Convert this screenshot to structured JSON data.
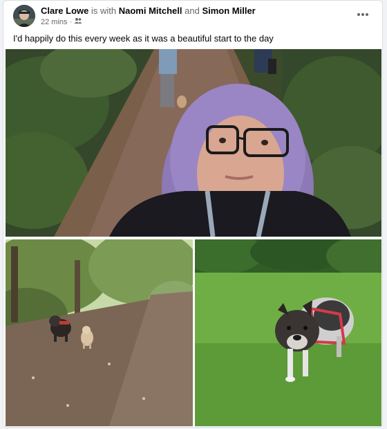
{
  "post": {
    "author": "Clare Lowe",
    "with_word": "is with",
    "tagged": [
      "Naomi Mitchell",
      "Simon Miller"
    ],
    "and_word": "and",
    "time": "22 mins",
    "separator": "·",
    "audience_icon": "friends-icon",
    "caption": "I'd happily do this every week as it was a beautiful start to the day",
    "more_icon": "more-options-icon"
  },
  "photos": [
    {
      "subject": "selfie-on-woodland-path"
    },
    {
      "subject": "dogs-on-path"
    },
    {
      "subject": "french-bulldog-on-grass"
    }
  ]
}
